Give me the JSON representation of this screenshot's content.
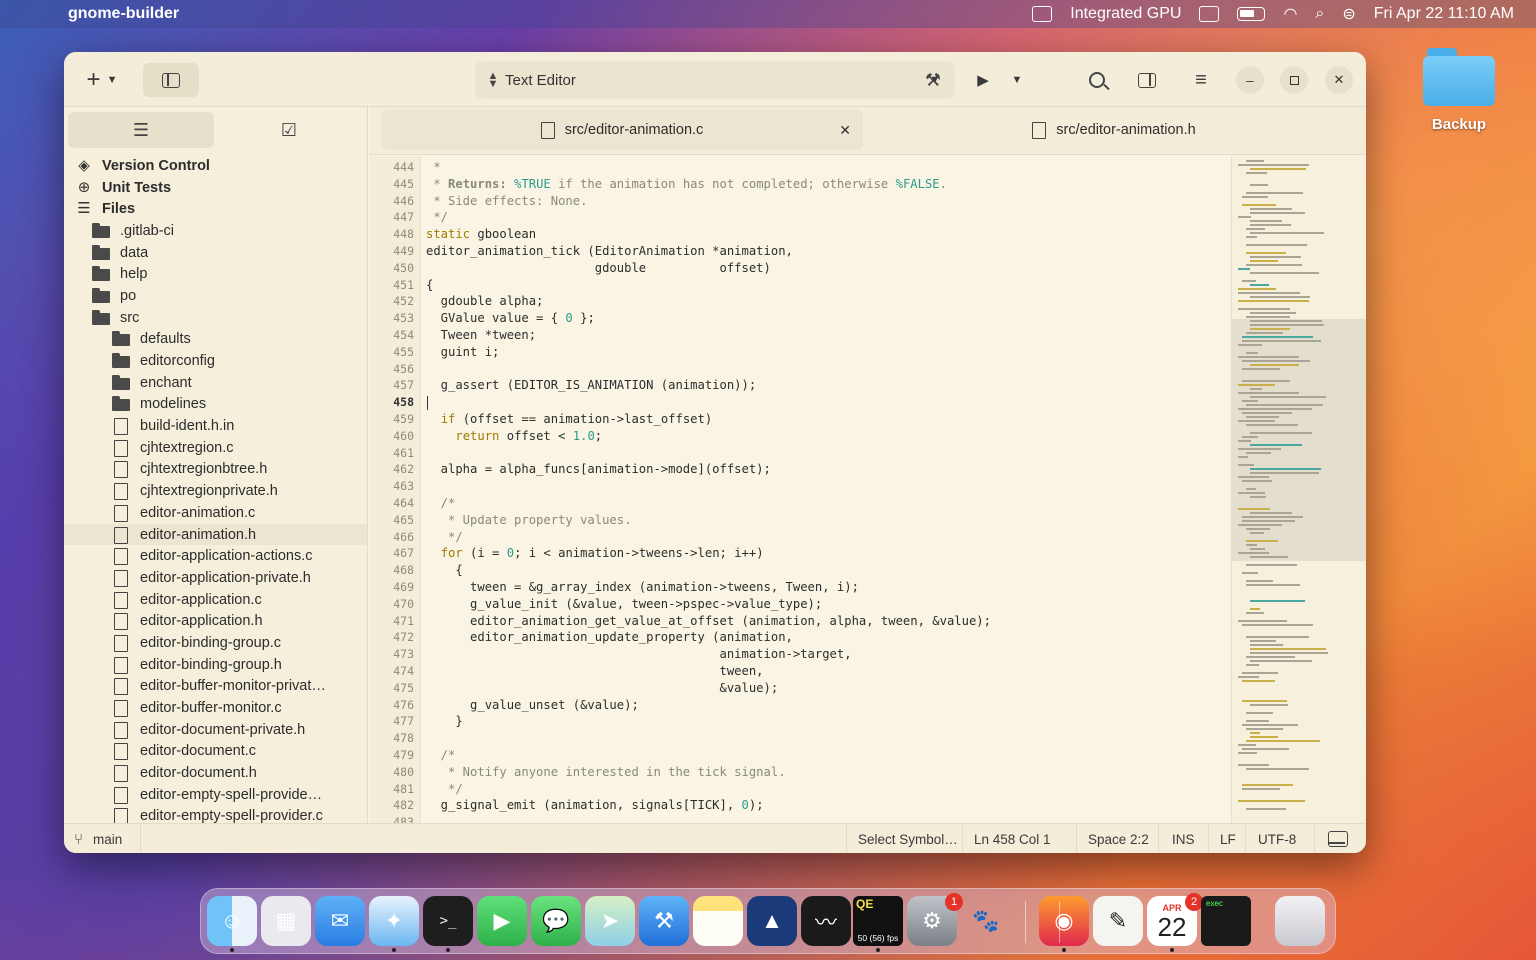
{
  "menubar": {
    "app_name": "gnome-builder",
    "gpu_label": "Integrated GPU",
    "datetime": "Fri Apr 22  11:10 AM"
  },
  "desktop": {
    "folder_label": "Backup"
  },
  "headerbar": {
    "title": "Text Editor"
  },
  "sidebar": {
    "items": [
      {
        "label": "Version Control",
        "kind": "vc",
        "indent": 0,
        "bold": true
      },
      {
        "label": "Unit Tests",
        "kind": "ut",
        "indent": 0,
        "bold": true
      },
      {
        "label": "Files",
        "kind": "files",
        "indent": 0,
        "bold": true
      },
      {
        "label": ".gitlab-ci",
        "kind": "folder",
        "indent": 1
      },
      {
        "label": "data",
        "kind": "folder",
        "indent": 1
      },
      {
        "label": "help",
        "kind": "folder",
        "indent": 1
      },
      {
        "label": "po",
        "kind": "folder",
        "indent": 1
      },
      {
        "label": "src",
        "kind": "folder",
        "indent": 1
      },
      {
        "label": "defaults",
        "kind": "folder",
        "indent": 2
      },
      {
        "label": "editorconfig",
        "kind": "folder",
        "indent": 2
      },
      {
        "label": "enchant",
        "kind": "folder",
        "indent": 2
      },
      {
        "label": "modelines",
        "kind": "folder",
        "indent": 2
      },
      {
        "label": "build-ident.h.in",
        "kind": "file",
        "indent": 2
      },
      {
        "label": "cjhtextregion.c",
        "kind": "file",
        "indent": 2
      },
      {
        "label": "cjhtextregionbtree.h",
        "kind": "file",
        "indent": 2
      },
      {
        "label": "cjhtextregionprivate.h",
        "kind": "file",
        "indent": 2
      },
      {
        "label": "editor-animation.c",
        "kind": "file",
        "indent": 2
      },
      {
        "label": "editor-animation.h",
        "kind": "file",
        "indent": 2,
        "selected": true
      },
      {
        "label": "editor-application-actions.c",
        "kind": "file",
        "indent": 2
      },
      {
        "label": "editor-application-private.h",
        "kind": "file",
        "indent": 2
      },
      {
        "label": "editor-application.c",
        "kind": "file",
        "indent": 2
      },
      {
        "label": "editor-application.h",
        "kind": "file",
        "indent": 2
      },
      {
        "label": "editor-binding-group.c",
        "kind": "file",
        "indent": 2
      },
      {
        "label": "editor-binding-group.h",
        "kind": "file",
        "indent": 2
      },
      {
        "label": "editor-buffer-monitor-privat…",
        "kind": "file",
        "indent": 2
      },
      {
        "label": "editor-buffer-monitor.c",
        "kind": "file",
        "indent": 2
      },
      {
        "label": "editor-document-private.h",
        "kind": "file",
        "indent": 2
      },
      {
        "label": "editor-document.c",
        "kind": "file",
        "indent": 2
      },
      {
        "label": "editor-document.h",
        "kind": "file",
        "indent": 2
      },
      {
        "label": "editor-empty-spell-provide…",
        "kind": "file",
        "indent": 2
      },
      {
        "label": "editor-empty-spell-provider.c",
        "kind": "file",
        "indent": 2
      }
    ]
  },
  "tabs": [
    {
      "label": "src/editor-animation.c",
      "active": true
    },
    {
      "label": "src/editor-animation.h",
      "active": false
    }
  ],
  "editor": {
    "current_line": 458,
    "lines": [
      {
        "n": 444,
        "text": " *",
        "kind": "comment"
      },
      {
        "n": 445,
        "text": " * Returns: %TRUE if the animation has not completed; otherwise %FALSE.",
        "kind": "comment"
      },
      {
        "n": 446,
        "text": " * Side effects: None.",
        "kind": "comment"
      },
      {
        "n": 447,
        "text": " */",
        "kind": "comment"
      },
      {
        "n": 448,
        "text": "static gboolean",
        "kind": "code"
      },
      {
        "n": 449,
        "text": "editor_animation_tick (EditorAnimation *animation,",
        "kind": "code"
      },
      {
        "n": 450,
        "text": "                       gdouble          offset)",
        "kind": "code"
      },
      {
        "n": 451,
        "text": "{",
        "kind": "code"
      },
      {
        "n": 452,
        "text": "  gdouble alpha;",
        "kind": "code"
      },
      {
        "n": 453,
        "text": "  GValue value = { 0 };",
        "kind": "code"
      },
      {
        "n": 454,
        "text": "  Tween *tween;",
        "kind": "code"
      },
      {
        "n": 455,
        "text": "  guint i;",
        "kind": "code"
      },
      {
        "n": 456,
        "text": "",
        "kind": "code"
      },
      {
        "n": 457,
        "text": "  g_assert (EDITOR_IS_ANIMATION (animation));",
        "kind": "code"
      },
      {
        "n": 458,
        "text": "",
        "kind": "code"
      },
      {
        "n": 459,
        "text": "  if (offset == animation->last_offset)",
        "kind": "code"
      },
      {
        "n": 460,
        "text": "    return offset < 1.0;",
        "kind": "code"
      },
      {
        "n": 461,
        "text": "",
        "kind": "code"
      },
      {
        "n": 462,
        "text": "  alpha = alpha_funcs[animation->mode](offset);",
        "kind": "code"
      },
      {
        "n": 463,
        "text": "",
        "kind": "code"
      },
      {
        "n": 464,
        "text": "  /*",
        "kind": "comment"
      },
      {
        "n": 465,
        "text": "   * Update property values.",
        "kind": "comment"
      },
      {
        "n": 466,
        "text": "   */",
        "kind": "comment"
      },
      {
        "n": 467,
        "text": "  for (i = 0; i < animation->tweens->len; i++)",
        "kind": "code"
      },
      {
        "n": 468,
        "text": "    {",
        "kind": "code"
      },
      {
        "n": 469,
        "text": "      tween = &g_array_index (animation->tweens, Tween, i);",
        "kind": "code"
      },
      {
        "n": 470,
        "text": "      g_value_init (&value, tween->pspec->value_type);",
        "kind": "code"
      },
      {
        "n": 471,
        "text": "      editor_animation_get_value_at_offset (animation, alpha, tween, &value);",
        "kind": "code"
      },
      {
        "n": 472,
        "text": "      editor_animation_update_property (animation,",
        "kind": "code"
      },
      {
        "n": 473,
        "text": "                                        animation->target,",
        "kind": "code"
      },
      {
        "n": 474,
        "text": "                                        tween,",
        "kind": "code"
      },
      {
        "n": 475,
        "text": "                                        &value);",
        "kind": "code"
      },
      {
        "n": 476,
        "text": "      g_value_unset (&value);",
        "kind": "code"
      },
      {
        "n": 477,
        "text": "    }",
        "kind": "code"
      },
      {
        "n": 478,
        "text": "",
        "kind": "code"
      },
      {
        "n": 479,
        "text": "  /*",
        "kind": "comment"
      },
      {
        "n": 480,
        "text": "   * Notify anyone interested in the tick signal.",
        "kind": "comment"
      },
      {
        "n": 481,
        "text": "   */",
        "kind": "comment"
      },
      {
        "n": 482,
        "text": "  g_signal_emit (animation, signals[TICK], 0);",
        "kind": "code"
      },
      {
        "n": 483,
        "text": "",
        "kind": "code"
      }
    ]
  },
  "statusbar": {
    "branch": "main",
    "symbol": "Select Symbol…",
    "position": "Ln  458  Col  1",
    "indent": "Space 2:2",
    "mode": "INS",
    "line_ending": "LF",
    "encoding": "UTF-8"
  },
  "dock": {
    "items": [
      {
        "name": "finder",
        "running": true
      },
      {
        "name": "launchpad"
      },
      {
        "name": "mail"
      },
      {
        "name": "safari",
        "running": true
      },
      {
        "name": "terminal",
        "running": true
      },
      {
        "name": "facetime"
      },
      {
        "name": "messages"
      },
      {
        "name": "maps"
      },
      {
        "name": "xcode"
      },
      {
        "name": "notes"
      },
      {
        "name": "instruments"
      },
      {
        "name": "activity-monitor"
      },
      {
        "name": "quartz-debug",
        "label": "50 (56) fps",
        "running": true
      },
      {
        "name": "system-preferences",
        "badge": "1"
      },
      {
        "name": "gimp"
      },
      {
        "name": "firefox",
        "running": true
      },
      {
        "name": "textedit"
      },
      {
        "name": "calendar",
        "month": "APR",
        "day": "22",
        "badge": "2",
        "running": true
      },
      {
        "name": "console",
        "label": "exec"
      },
      {
        "name": "trash"
      }
    ]
  },
  "colors": {
    "window_bg": "#f9f4e3",
    "keyword": "#a07a00",
    "number": "#2a9d8f",
    "comment": "#8a8a78"
  }
}
